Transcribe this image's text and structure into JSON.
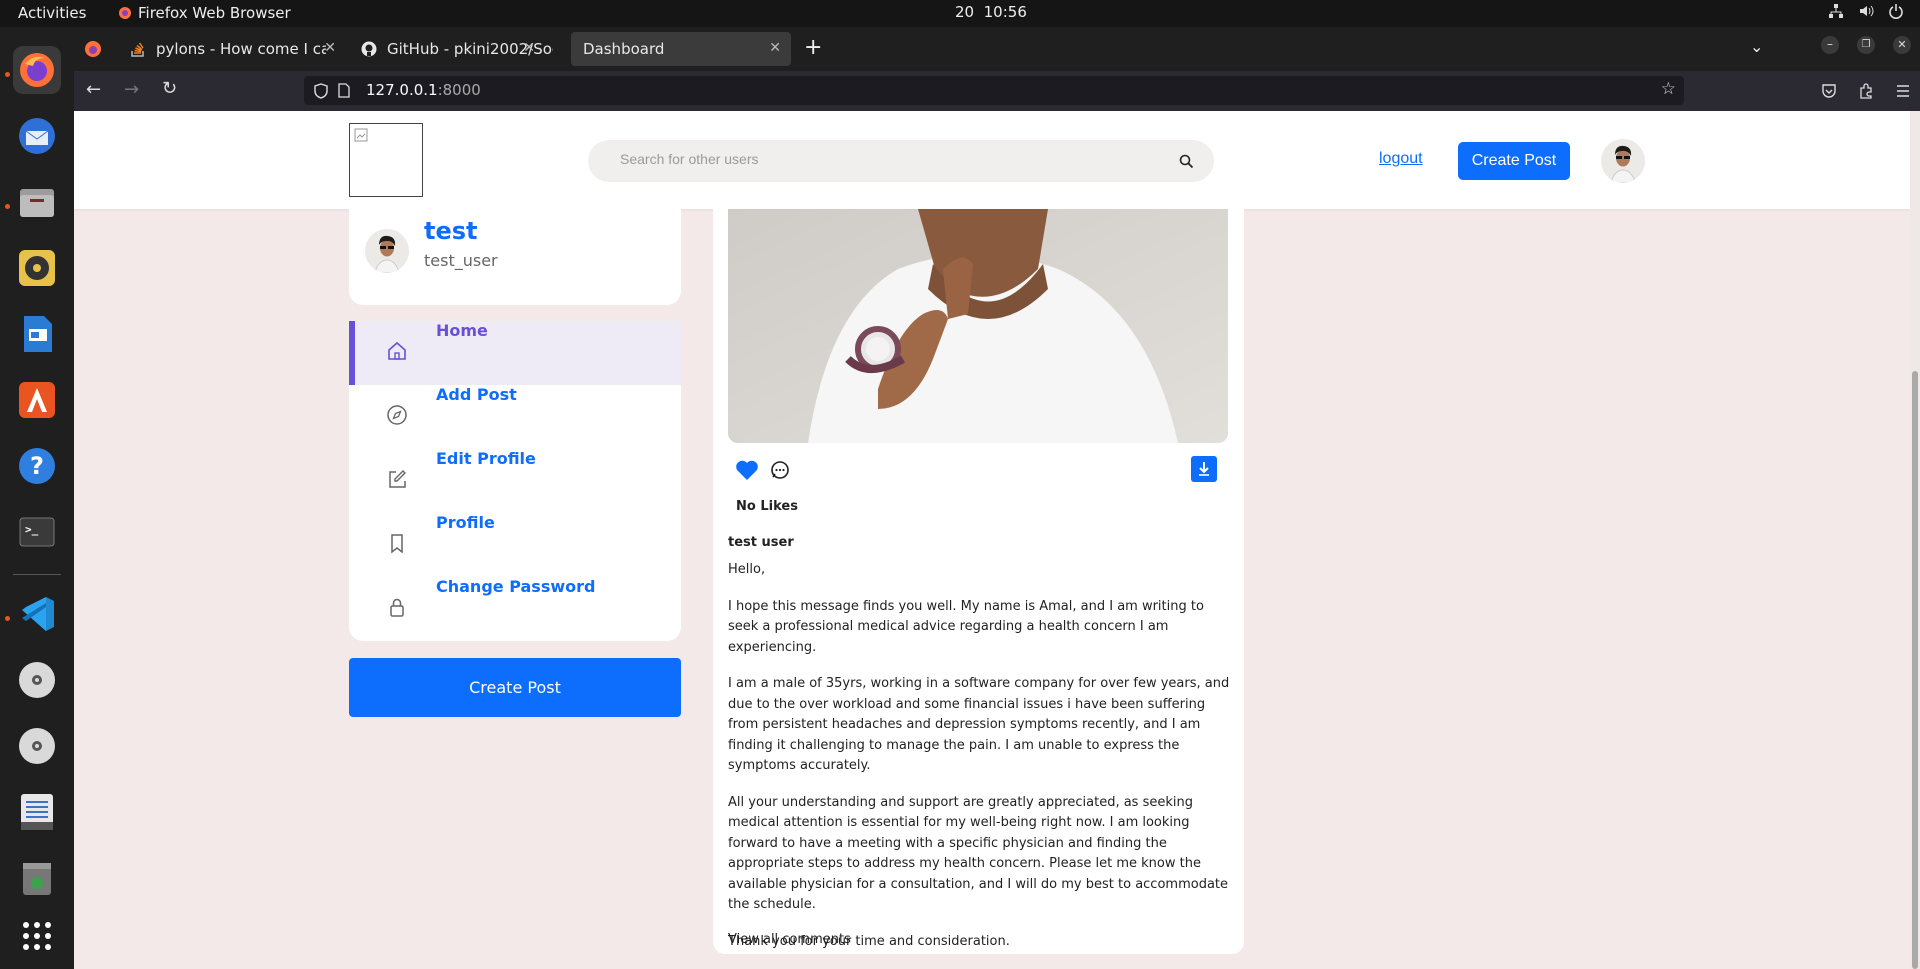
{
  "system": {
    "activities": "Activities",
    "app_name": "Firefox Web Browser",
    "clock_date": "20",
    "clock_time": "10:56"
  },
  "browser": {
    "tabs": [
      {
        "label": "pylons - How come I can r"
      },
      {
        "label": "GitHub - pkini2002/Social"
      },
      {
        "label": "Dashboard"
      }
    ],
    "url_host": "127.0.0.1",
    "url_port": ":8000"
  },
  "header": {
    "search_placeholder": "Search for other users",
    "logout": "logout",
    "create_post": "Create Post"
  },
  "profile": {
    "name": "test",
    "username": "test_user"
  },
  "menu": {
    "items": [
      {
        "label": "Home",
        "icon": "home-icon",
        "active": true
      },
      {
        "label": "Add Post",
        "icon": "compass-icon"
      },
      {
        "label": "Edit Profile",
        "icon": "edit-icon"
      },
      {
        "label": "Profile",
        "icon": "bookmark-icon"
      },
      {
        "label": "Change Password",
        "icon": "lock-icon"
      }
    ],
    "create_post": "Create Post"
  },
  "post": {
    "likes": "No Likes",
    "author": "test user",
    "paragraphs": [
      "Hello,",
      "I hope this message finds you well. My name is Amal, and I am writing to seek a professional medical advice regarding a health concern I am experiencing.",
      "I am a male of 35yrs, working in a software company for over few years, and due to the over workload and some financial issues i have been suffering from persistent headaches and depression symptoms recently, and I am finding it challenging to manage the pain. I am unable to express the symptoms accurately.",
      "All your understanding and support are greatly appreciated, as seeking medical attention is essential for my well-being right now. I am looking forward to have a meeting with a specific physician and finding the appropriate steps to address my health concern. Please let me know the available physician for a consultation, and I will do my best to accommodate the schedule.",
      "Thank you for your time and consideration."
    ],
    "view_all": "View all comments"
  },
  "colors": {
    "primary": "#0d6efd",
    "active_menu": "#6a4fd8",
    "page_bg": "#f3e9e9"
  }
}
